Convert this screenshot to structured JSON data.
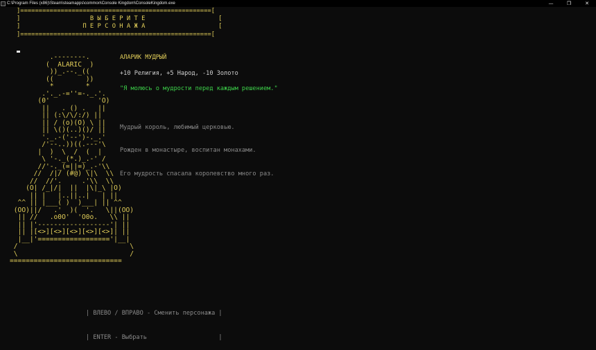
{
  "window": {
    "title": "C:\\Program Files (x86)\\Steam\\steamapps\\common\\Console Kingdom\\ConsoleKingdom.exe",
    "minimize_glyph": "—",
    "maximize_glyph": "❐",
    "close_glyph": "✕"
  },
  "header": {
    "border_top": "]====================================================[",
    "line1": "]                   В Ы Б Е Р И Т Е                    [",
    "line2": "]                 П Е Р С О Н А Ж А                    [",
    "border_bottom": "]====================================================["
  },
  "character": {
    "art": "          .--------.\n         (  ALARIC  )\n          ))_.--._((\n         ((        ))\n          *        *\n        .'._.-=''=-._.'.\n       (0'            'O)\n        ||   . () .   ||\n        || (:\\/\\/:/) ||\n        || / (o)(O) \\ ||\n        || \\()(..)()/ ||\n        '._.-('--')-._.'\n        /'--..))((.---'\\\n       |  )  \\  /  (  |\n        \\ '-._(*.)_.-' /\n       //'-._(=||=)_.-'\\\\\n      //  /|/ (#@) \\|\\  \\\\\n     //  //'.     .'\\\\  \\\\\n    (O| /_|/|  ||  |\\|_\\ |O)\n     || |   |..||..|   | ||\n  ^^ || |___( )  )___| || ^^\n (OO)||/   .'  )(  '.   \\||(OO)\n  || //   .o0O'  'O0o.   \\\\ ||\n  || |'------------------'| ||\n  || |[<>][<>][<>][<>][<>]| ||\n  |__|'=================='|__|\n /                            \\\n \\                            /\n============================",
    "name": "АЛАРИК МУДРЫЙ",
    "stats": "+10 Религия, +5 Народ, -10 Золото",
    "quote": "\"Я молюсь о мудрости перед каждым решением.\"",
    "description": [
      "Мудрый король, любимый церковью.",
      "Рожден в монастыре, воспитан монахами.",
      "Его мудрость спасала королевство много раз."
    ]
  },
  "controls": {
    "line1": "| ВЛЕВО / ВПРАВО - Сменить персонажа |",
    "line2": "| ENTER - Выбрать                    |"
  },
  "colors": {
    "background": "#0c0c0c",
    "accent_yellow": "#e3cf5a",
    "quote_green": "#3dd14a",
    "muted_gray": "#8a8a8a"
  }
}
